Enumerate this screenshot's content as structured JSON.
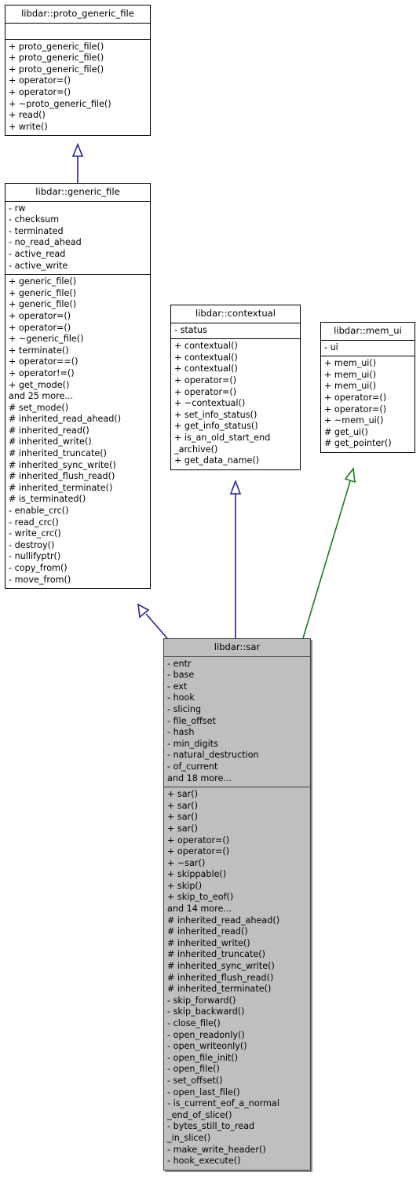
{
  "diagram": {
    "kind": "uml-class-inheritance-diagram",
    "colors": {
      "public_inheritance_edge": "#26268c",
      "protected_inheritance_edge": "#1b7a1b",
      "highlight_class_fill": "#bfbfbf",
      "class_border": "#000000",
      "background": "#ffffff"
    }
  },
  "classes": {
    "proto_generic_file": {
      "name": "libdar::proto_generic_file",
      "attributes": [],
      "operations": [
        "+ proto_generic_file()",
        "+ proto_generic_file()",
        "+ proto_generic_file()",
        "+ operator=()",
        "+ operator=()",
        "+ ~proto_generic_file()",
        "+ read()",
        "+ write()"
      ]
    },
    "generic_file": {
      "name": "libdar::generic_file",
      "attributes": [
        "- rw",
        "- checksum",
        "- terminated",
        "- no_read_ahead",
        "- active_read",
        "- active_write"
      ],
      "operations": [
        "+ generic_file()",
        "+ generic_file()",
        "+ generic_file()",
        "+ operator=()",
        "+ operator=()",
        "+ ~generic_file()",
        "+ terminate()",
        "+ operator==()",
        "+ operator!=()",
        "+ get_mode()",
        "and 25 more...",
        "# set_mode()",
        "# inherited_read_ahead()",
        "# inherited_read()",
        "# inherited_write()",
        "# inherited_truncate()",
        "# inherited_sync_write()",
        "# inherited_flush_read()",
        "# inherited_terminate()",
        "# is_terminated()",
        "- enable_crc()",
        "- read_crc()",
        "- write_crc()",
        "- destroy()",
        "- nullifyptr()",
        "- copy_from()",
        "- move_from()"
      ]
    },
    "contextual": {
      "name": "libdar::contextual",
      "attributes": [
        "- status"
      ],
      "operations": [
        "+ contextual()",
        "+ contextual()",
        "+ contextual()",
        "+ operator=()",
        "+ operator=()",
        "+ ~contextual()",
        "+ set_info_status()",
        "+ get_info_status()",
        "+ is_an_old_start_end\n_archive()",
        "+ get_data_name()"
      ]
    },
    "mem_ui": {
      "name": "libdar::mem_ui",
      "attributes": [
        "- ui"
      ],
      "operations": [
        "+ mem_ui()",
        "+ mem_ui()",
        "+ mem_ui()",
        "+ operator=()",
        "+ operator=()",
        "+ ~mem_ui()",
        "# get_ui()",
        "# get_pointer()"
      ]
    },
    "sar": {
      "name": "libdar::sar",
      "attributes": [
        "- entr",
        "- base",
        "- ext",
        "- hook",
        "- slicing",
        "- file_offset",
        "- hash",
        "- min_digits",
        "- natural_destruction",
        "- of_current",
        "and 18 more..."
      ],
      "operations": [
        "+ sar()",
        "+ sar()",
        "+ sar()",
        "+ sar()",
        "+ operator=()",
        "+ operator=()",
        "+ ~sar()",
        "+ skippable()",
        "+ skip()",
        "+ skip_to_eof()",
        "and 14 more...",
        "# inherited_read_ahead()",
        "# inherited_read()",
        "# inherited_write()",
        "# inherited_truncate()",
        "# inherited_sync_write()",
        "# inherited_flush_read()",
        "# inherited_terminate()",
        "- skip_forward()",
        "- skip_backward()",
        "- close_file()",
        "- open_readonly()",
        "- open_writeonly()",
        "- open_file_init()",
        "- open_file()",
        "- set_offset()",
        "- open_last_file()",
        "- is_current_eof_a_normal\n_end_of_slice()",
        "- bytes_still_to_read\n_in_slice()",
        "- make_write_header()",
        "- hook_execute()"
      ]
    }
  },
  "edges": [
    {
      "id": "generic_file-to-proto_generic_file",
      "from": "generic_file",
      "to": "proto_generic_file",
      "relation": "public inheritance",
      "color": "#26268c"
    },
    {
      "id": "sar-to-generic_file",
      "from": "sar",
      "to": "generic_file",
      "relation": "public inheritance",
      "color": "#26268c"
    },
    {
      "id": "sar-to-contextual",
      "from": "sar",
      "to": "contextual",
      "relation": "public inheritance",
      "color": "#26268c"
    },
    {
      "id": "sar-to-mem_ui",
      "from": "sar",
      "to": "mem_ui",
      "relation": "protected inheritance",
      "color": "#1b7a1b"
    }
  ]
}
